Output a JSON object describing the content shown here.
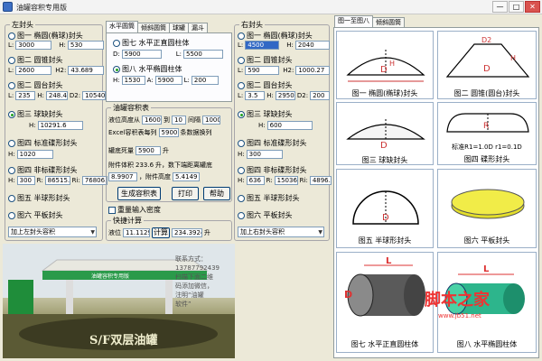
{
  "window": {
    "title": "油罐容积专用版",
    "min": "—",
    "max": "□",
    "close": "✕"
  },
  "left": {
    "legend": "左封头",
    "r1": {
      "label": "图一 椭圆(椭球)封头",
      "a_label": "L:",
      "a": "3000",
      "b_label": "H:",
      "b": "530"
    },
    "r2": {
      "label": "图二 圆锥封头",
      "a_label": "L:",
      "a": "2600",
      "b_label": "H2:",
      "b": "43.689"
    },
    "r3": {
      "label": "图二 圆台封头",
      "a_label": "L:",
      "a": "235",
      "b_label": "H:",
      "b": "248.4",
      "c_label": "D2:",
      "c": "10540"
    },
    "r4": {
      "label": "图三 球缺封头",
      "b_label": "H:",
      "b": "10291.6"
    },
    "r5": {
      "label": "图四 标准碟形封头",
      "b_label": "H:",
      "b": "1020"
    },
    "r6": {
      "label": "图四 非标碟形封头",
      "a_label": "H:",
      "a": "300",
      "b_label": "R:",
      "b": "86515.",
      "c_label": "Ri:",
      "c": "76806.6"
    },
    "r7": {
      "label": "图五 半球形封头"
    },
    "r8": {
      "label": "图六 平板封头"
    },
    "combo": "加上左封头容积"
  },
  "middle": {
    "tabs": [
      "水平圆筒",
      "倾斜圆筒",
      "球罐",
      "漏斗"
    ],
    "body_legend": "罐体",
    "r9": {
      "label": "图七 水平正直圆柱体",
      "a_label": "D:",
      "a": "5900",
      "b_label": "L:",
      "b": "5500"
    },
    "r10": {
      "label": "图八 水平椭圆柱体",
      "a_label": "H:",
      "a": "1530",
      "b_label": "A:",
      "b": "5900",
      "c_label": "L:",
      "c": "200"
    },
    "table_legend": "油罐容积表",
    "tbl1": {
      "label1": "液位高度从",
      "v1": "1600",
      "label2": "到",
      "v2": "10",
      "label3": "间隔",
      "v3": "1000"
    },
    "tbl2": {
      "label": "Excel容积表每列",
      "v": "5900",
      "label2": "条数据换列"
    },
    "tbl3": {
      "label": "罐底死量",
      "v": "5900",
      "unit": "升"
    },
    "tbl4": {
      "label": "附件体积",
      "v": "233.6",
      "unit": "升，数下端距离罐底"
    },
    "tbl5": {
      "v": "8.9907",
      "label": "，附件高度",
      "v2": "5.4149"
    },
    "buttons": {
      "generate": "生成容积表",
      "print": "打印",
      "help": "帮助"
    },
    "chk_density": "重量输入密度",
    "quick_legend": "快捷计算",
    "quick": {
      "label": "液位",
      "v": "11.1129",
      "btn": "计算",
      "result": "234.3924",
      "unit": "升"
    }
  },
  "right": {
    "legend": "右封头",
    "r1": {
      "label": "图一 椭圆(椭球)封头",
      "a_label": "L:",
      "a": "4500",
      "b_label": "H:",
      "b": "2040"
    },
    "r2": {
      "label": "图二 圆锥封头",
      "a_label": "L:",
      "a": "590",
      "b_label": "H2:",
      "b": "1000.27"
    },
    "r3": {
      "label": "图二 圆台封头",
      "a_label": "L:",
      "a": "3.5",
      "b_label": "H:",
      "b": "2950",
      "c_label": "D2:",
      "c": "200"
    },
    "r4": {
      "label": "图三 球缺封头",
      "b_label": "H:",
      "b": "600"
    },
    "r5": {
      "label": "图四 标准碟形封头",
      "b_label": "H:",
      "b": "300"
    },
    "r6": {
      "label": "图四 非标碟形封头",
      "a_label": "H:",
      "a": "636",
      "b_label": "R:",
      "b": "15036",
      "c_label": "Ri:",
      "c": "4896."
    },
    "r7": {
      "label": "图五 半球形封头"
    },
    "r8": {
      "label": "图六 平板封头"
    },
    "combo": "加上右封头容积"
  },
  "diagrams": {
    "tabs": [
      "图一至图八",
      "倾斜圆筒"
    ],
    "captions": [
      "图一 椭圆(椭球)封头",
      "图二 圆锥(圆台)封头",
      "图三 球缺封头",
      "图四 碟形封头",
      "图五 半球形封头",
      "图六 平板封头",
      "图七 水平正直圆柱体",
      "图八 水平椭圆柱体"
    ],
    "note": "标准R1=1.0D  r1=0.1D",
    "dim_D": "D",
    "dim_L": "L",
    "dim_H": "H"
  },
  "banner": {
    "contact": "联系方式：\n13787792439\n扫描下面二维\n码添加微信，\n注明“油罐\n软件”",
    "station": "油罐容积专用版",
    "slogan": "S/F双层油罐",
    "watermark": "脚本之家",
    "watermark_url": "www.jb51.net"
  },
  "colors": {
    "accent": "#3168c5",
    "radio_on": "#21a121"
  }
}
